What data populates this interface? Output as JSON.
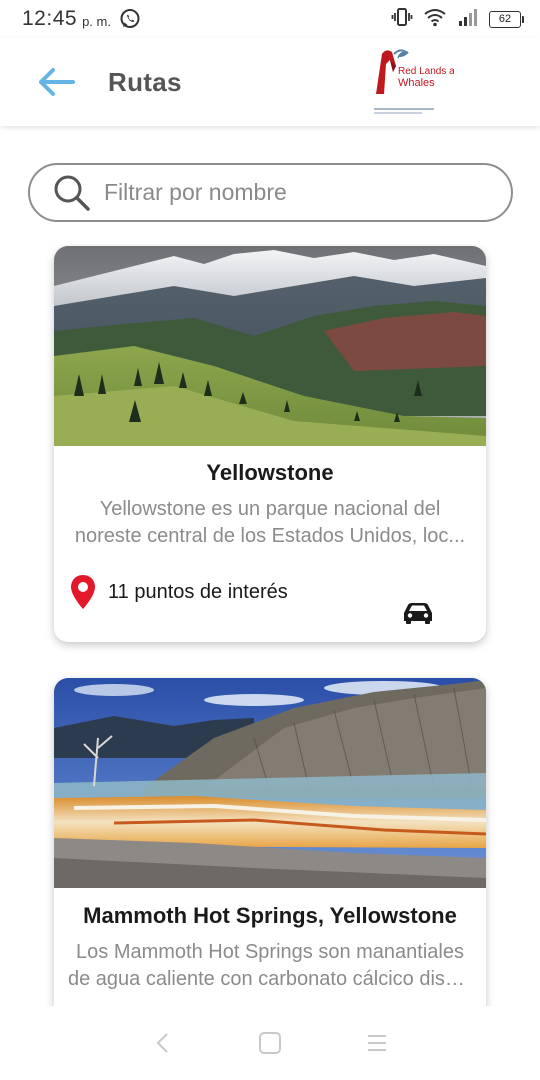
{
  "status_bar": {
    "time": "12:45",
    "ampm": "p. m.",
    "battery": "62",
    "icons": [
      "whatsapp-icon",
      "vibrate-icon",
      "wifi-icon",
      "signal-icon",
      "battery-icon"
    ]
  },
  "app_bar": {
    "title": "Rutas",
    "back_icon": "arrow-left-icon",
    "logo": {
      "line1": "Red Lands and",
      "line2": "Whales"
    }
  },
  "search": {
    "placeholder": "Filtrar por nombre",
    "value": ""
  },
  "routes": [
    {
      "title": "Yellowstone",
      "description_line1": "Yellowstone es un parque nacional del",
      "description_line2": "noreste central  de los  Estados Unidos, loc...",
      "points_of_interest": "11 puntos de interés",
      "transport_icon": "car-icon"
    },
    {
      "title": "Mammoth Hot Springs, Yellowstone",
      "description_line1": "Los Mammoth Hot Springs son manantiales",
      "description_line2": "de agua caliente con carbonato cálcico disu..."
    }
  ],
  "colors": {
    "accent": "#64b5e6",
    "title_text": "#555555",
    "pin": "#e3192b",
    "desc_text": "#8b8b8b"
  },
  "nav_bar": {
    "icons": [
      "back-nav-icon",
      "home-nav-icon",
      "menu-nav-icon"
    ]
  }
}
